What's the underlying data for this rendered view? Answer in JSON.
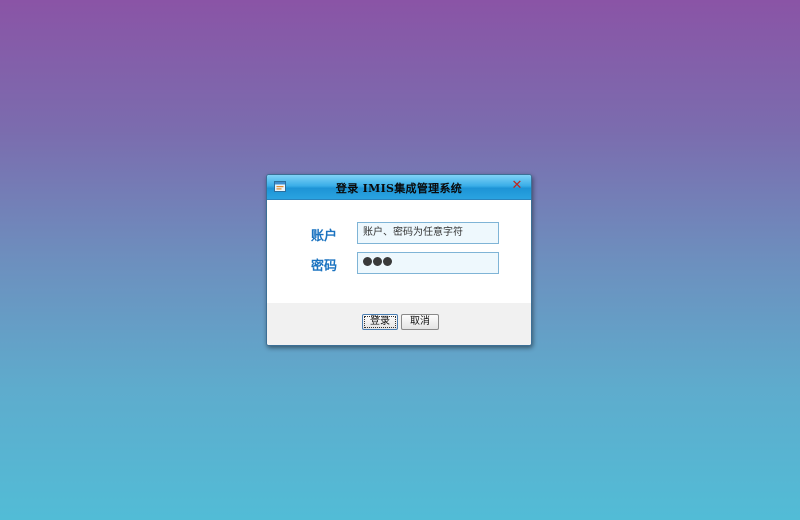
{
  "dialog": {
    "title": "登录 IMIS集成管理系统",
    "close_icon": "close-icon",
    "app_icon": "window-app-icon"
  },
  "form": {
    "account_label": "账户",
    "account_placeholder": "账户、密码为任意字符",
    "password_label": "密码",
    "password_masked_length": 3
  },
  "buttons": {
    "login_label": "登录",
    "cancel_label": "取消"
  },
  "colors": {
    "title_bar": "#2aa3e0",
    "label_text": "#1b73c0",
    "close_x": "#c0261e"
  }
}
